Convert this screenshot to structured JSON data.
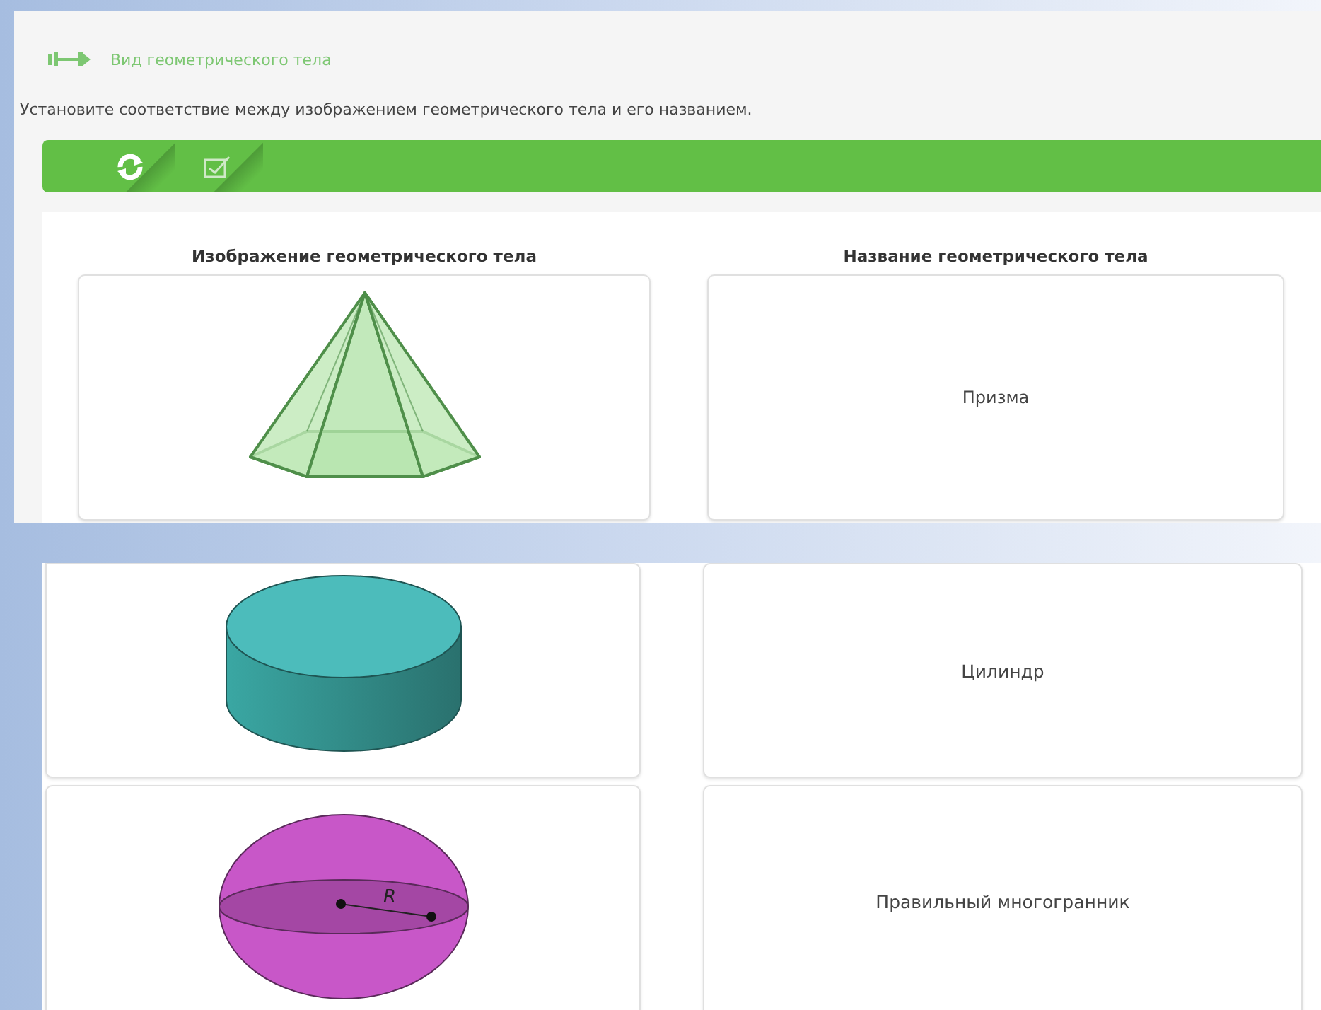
{
  "task": {
    "title": "Вид геометрического тела",
    "instruction": "Установите соответствие между изображением геометрического тела и его названием."
  },
  "toolbar": [
    {
      "kind": "refresh"
    },
    {
      "kind": "check"
    }
  ],
  "top_panel": {
    "column_headings": [
      "Изображение геометрического тела",
      "Название геометрического тела"
    ],
    "rows": [
      {
        "figure": {
          "kind": "pyramid"
        },
        "name": "Призма"
      }
    ]
  },
  "bottom_panel": {
    "rows": [
      {
        "figure": {
          "kind": "cylinder"
        },
        "name": "Цилиндр"
      },
      {
        "figure": {
          "kind": "sphere",
          "label": "R"
        },
        "name": "Правильный многогранник"
      }
    ]
  }
}
